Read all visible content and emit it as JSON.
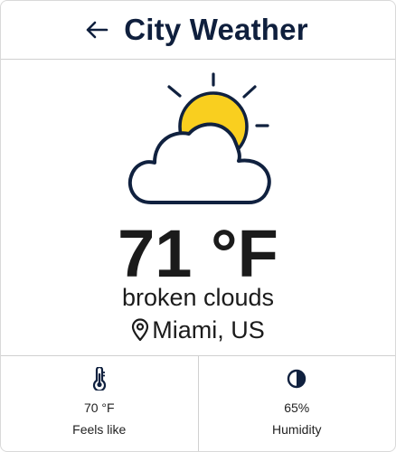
{
  "header": {
    "title": "City Weather",
    "back_icon": "arrow-left-icon"
  },
  "current": {
    "temperature": "71 °F",
    "description": "broken clouds",
    "location": "Miami, US",
    "icon": "partly-cloudy-icon"
  },
  "stats": [
    {
      "icon": "thermometer-icon",
      "value": "70 °F",
      "label": "Feels like"
    },
    {
      "icon": "humidity-drop-icon",
      "value": "65%",
      "label": "Humidity"
    }
  ],
  "colors": {
    "title": "#0f1f3d",
    "sun": "#f9cf1f",
    "outline": "#10213f",
    "divider": "#d0d0d0"
  }
}
